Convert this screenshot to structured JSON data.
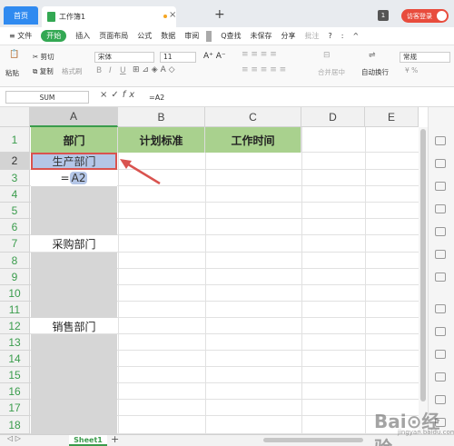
{
  "titlebar": {
    "home_tab": "首页",
    "doc_tab": "工作簿1",
    "close": "×",
    "new_tab": "+",
    "badge": "1",
    "login": "访客登录"
  },
  "menu": {
    "items": [
      "≡ 文件",
      "开始",
      "插入",
      "页面布局",
      "公式",
      "数据",
      "审阅",
      "Q查找",
      "未保存",
      "分享",
      "批注",
      "?",
      ":",
      "^"
    ]
  },
  "ribbon": {
    "paste": "粘贴",
    "cut": "剪切",
    "copy": "复制",
    "format_painter": "格式刷",
    "font": "宋体",
    "size": "11",
    "bold": "B",
    "italic": "I",
    "underline": "U",
    "merge": "合并居中",
    "wrap": "自动换行",
    "number_format": "常规",
    "percent": "¥ %"
  },
  "formula_bar": {
    "name_box": "SUM",
    "cancel": "×",
    "confirm": "✓",
    "fx": "fx",
    "formula": "=A2"
  },
  "grid": {
    "columns": [
      "A",
      "B",
      "C",
      "D",
      "E"
    ],
    "rows": [
      "1",
      "2",
      "3",
      "4",
      "5",
      "6",
      "7",
      "8",
      "9",
      "10",
      "11",
      "12",
      "13",
      "14",
      "15",
      "16",
      "17",
      "18"
    ],
    "header": {
      "a": "部门",
      "b": "计划标准",
      "c": "工作时间"
    },
    "a2": "生产部门",
    "a3_prefix": "=",
    "a3_ref": "A2",
    "a7": "采购部门",
    "a12": "销售部门"
  },
  "sheets": {
    "tabs": [
      "Sheet1"
    ],
    "add": "+"
  },
  "watermark": {
    "main": "Bai⊙经验",
    "sub": "jingyan.baidu.com"
  },
  "colors": {
    "accent": "#33a853",
    "header_fill": "#a9d18e",
    "selection": "#b4c6e7",
    "arrow": "#d9534f"
  }
}
